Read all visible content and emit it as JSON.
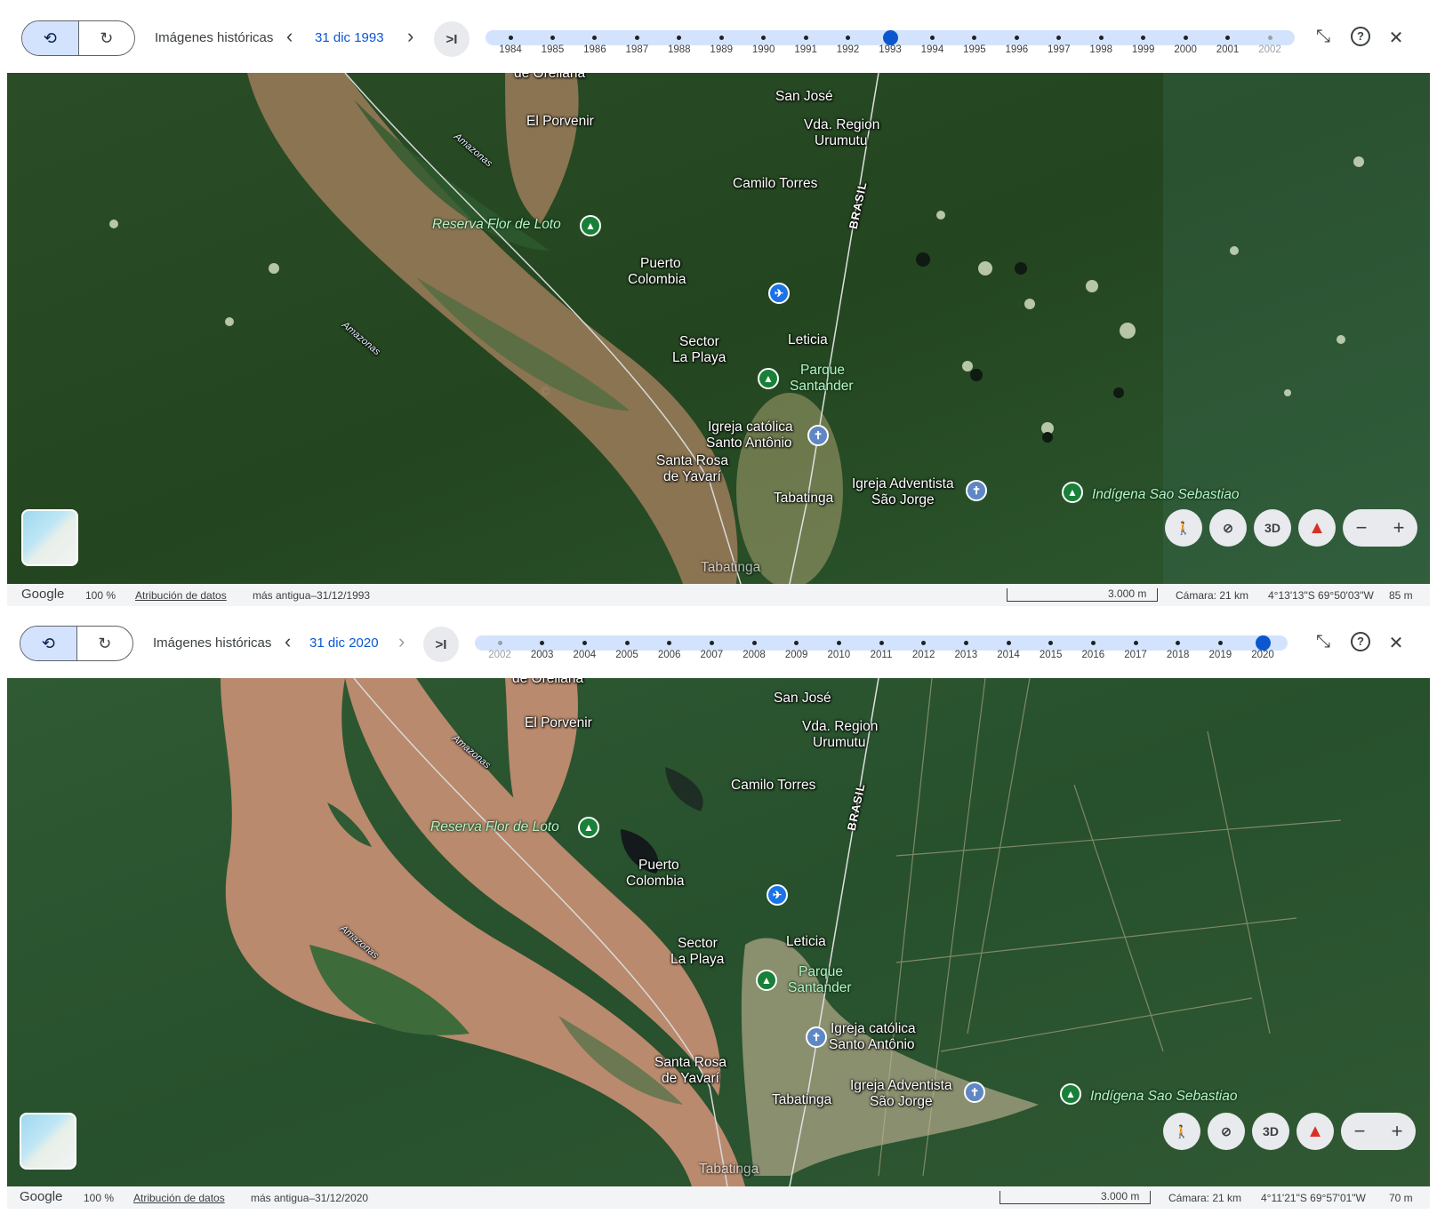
{
  "panels": [
    {
      "toolbar": {
        "title": "Imágenes históricas",
        "date": "31 dic 1993",
        "latest_label": ">I",
        "prev_arrow": "‹",
        "next_arrow": "›"
      },
      "timeline": {
        "years": [
          "1984",
          "1985",
          "1986",
          "1987",
          "1988",
          "1989",
          "1990",
          "1991",
          "1992",
          "1993",
          "1994",
          "1995",
          "1996",
          "1997",
          "1998",
          "1999",
          "2000",
          "2001",
          "2002"
        ],
        "selected_year": "1993",
        "faint_years": [
          "2002"
        ]
      },
      "map": {
        "labels": {
          "de_orellana": "de Orellana",
          "el_porvenir": "El Porvenir",
          "san_jose": "San José",
          "vda_region": "Vda. Region",
          "urumutu": "Urumutu",
          "camilo_torres": "Camilo Torres",
          "reserva": "Reserva Flor de Loto",
          "puerto": "Puerto",
          "colombia": "Colombia",
          "sector": "Sector",
          "la_playa": "La Playa",
          "leticia": "Leticia",
          "parque": "Parque",
          "santander": "Santander",
          "igreja_cat1": "Igreja católica",
          "igreja_cat2": "Santo Antônio",
          "santa_rosa": "Santa Rosa",
          "de_yavari": "de Yavarí",
          "tabatinga": "Tabatinga",
          "igreja_adv1": "Igreja Adventista",
          "igreja_adv2": "São Jorge",
          "indigena": "Indígena Sao Sebastiao",
          "amazonas1": "Amazonas",
          "amazonas2": "Amazonas",
          "brasil": "BRASIL",
          "tabatinga_airport": "Tabatinga"
        }
      },
      "controls": {
        "three_d": "3D",
        "zoom_out": "−",
        "zoom_in": "+"
      },
      "statusbar": {
        "brand": "Google",
        "zoom": "100 %",
        "attribution": "Atribución de datos",
        "oldest": "más antigua–31/12/1993",
        "scale": "3.000 m",
        "camera": "Cámara: 21 km",
        "coords": "4°13'13\"S 69°50'03\"W",
        "elevation": "85 m"
      }
    },
    {
      "toolbar": {
        "title": "Imágenes históricas",
        "date": "31 dic 2020",
        "latest_label": ">I",
        "prev_arrow": "‹",
        "next_arrow": "›"
      },
      "timeline": {
        "years": [
          "2002",
          "2003",
          "2004",
          "2005",
          "2006",
          "2007",
          "2008",
          "2009",
          "2010",
          "2011",
          "2012",
          "2013",
          "2014",
          "2015",
          "2016",
          "2017",
          "2018",
          "2019",
          "2020"
        ],
        "selected_year": "2020",
        "faint_years": [
          "2002"
        ]
      },
      "map": {
        "labels": {
          "de_orellana": "de Orellana",
          "el_porvenir": "El Porvenir",
          "san_jose": "San José",
          "vda_region": "Vda. Region",
          "urumutu": "Urumutu",
          "camilo_torres": "Camilo Torres",
          "reserva": "Reserva Flor de Loto",
          "puerto": "Puerto",
          "colombia": "Colombia",
          "sector": "Sector",
          "la_playa": "La Playa",
          "leticia": "Leticia",
          "parque": "Parque",
          "santander": "Santander",
          "igreja_cat1": "Igreja católica",
          "igreja_cat2": "Santo Antônio",
          "santa_rosa": "Santa Rosa",
          "de_yavari": "de Yavarí",
          "tabatinga": "Tabatinga",
          "igreja_adv1": "Igreja Adventista",
          "igreja_adv2": "São Jorge",
          "indigena": "Indígena Sao Sebastiao",
          "amazonas1": "Amazonas",
          "amazonas2": "Amazonas",
          "brasil": "BRASIL",
          "tabatinga_airport": "Tabatinga"
        }
      },
      "controls": {
        "three_d": "3D",
        "zoom_out": "−",
        "zoom_in": "+"
      },
      "statusbar": {
        "brand": "Google",
        "zoom": "100 %",
        "attribution": "Atribución de datos",
        "oldest": "más antigua–31/12/2020",
        "scale": "3.000 m",
        "camera": "Cámara: 21 km",
        "coords": "4°11'21\"S 69°57'01\"W",
        "elevation": "70 m"
      }
    }
  ],
  "colors": {
    "accent": "#0b57d0",
    "timeline_track": "#d3e3fd",
    "forest_1993": "#274a26",
    "river_1993": "#8a7452",
    "forest_2020": "#2b5230",
    "river_2020": "#b98a6e",
    "park_pin": "#188038",
    "airport_pin": "#1a73e8"
  },
  "icons": {
    "history": "history-rewind-icon",
    "refresh": "refresh-icon",
    "collapse": "collapse-icon",
    "help": "help-icon",
    "close": "close-icon",
    "pegman": "pegman-icon",
    "location_off": "location-off-icon",
    "compass": "compass-icon",
    "park": "park-tree-icon",
    "airport": "airport-icon",
    "church": "church-icon"
  }
}
